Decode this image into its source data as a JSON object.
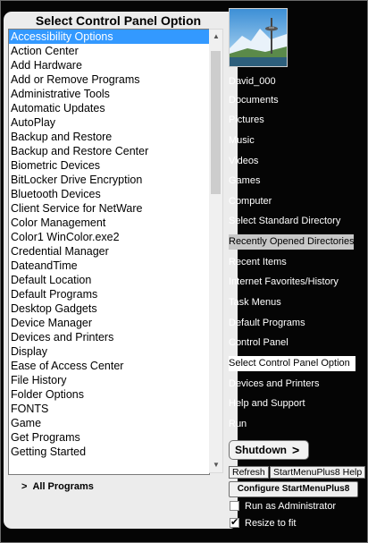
{
  "left_panel": {
    "title": "Select Control Panel Option",
    "items": [
      {
        "label": "Accessibility Options",
        "selected": true
      },
      {
        "label": "Action Center"
      },
      {
        "label": "Add Hardware"
      },
      {
        "label": "Add or Remove Programs"
      },
      {
        "label": "Administrative Tools"
      },
      {
        "label": "Automatic Updates"
      },
      {
        "label": "AutoPlay"
      },
      {
        "label": "Backup and Restore"
      },
      {
        "label": "Backup and Restore Center"
      },
      {
        "label": "Biometric Devices"
      },
      {
        "label": "BitLocker Drive Encryption"
      },
      {
        "label": "Bluetooth Devices"
      },
      {
        "label": "Client Service for NetWare"
      },
      {
        "label": "Color Management"
      },
      {
        "label": "Color1 WinColor.exe2"
      },
      {
        "label": "Credential Manager"
      },
      {
        "label": "DateandTime"
      },
      {
        "label": "Default Location"
      },
      {
        "label": "Default Programs"
      },
      {
        "label": "Desktop Gadgets"
      },
      {
        "label": "Device Manager"
      },
      {
        "label": "Devices and Printers"
      },
      {
        "label": "Display"
      },
      {
        "label": "Ease of Access Center"
      },
      {
        "label": "File History"
      },
      {
        "label": "Folder Options"
      },
      {
        "label": "FONTS"
      },
      {
        "label": "Game"
      },
      {
        "label": "Get Programs"
      },
      {
        "label": "Getting Started"
      }
    ],
    "all_programs": {
      "arrow": ">",
      "label": "All Programs"
    }
  },
  "right_panel": {
    "avatar_icon": "user-picture-space-needle",
    "items": [
      {
        "label": "David_000",
        "name": "user-name"
      },
      {
        "label": "Documents",
        "name": "menu-item-documents"
      },
      {
        "label": "Pictures",
        "name": "menu-item-pictures"
      },
      {
        "label": "Music",
        "name": "menu-item-music"
      },
      {
        "label": "Videos",
        "name": "menu-item-videos"
      },
      {
        "label": "Games",
        "name": "menu-item-games"
      },
      {
        "label": "Computer",
        "name": "menu-item-computer"
      },
      {
        "label": "Select Standard Directory",
        "name": "menu-item-select-standard-directory"
      },
      {
        "label": "Recently Opened Directories",
        "name": "menu-item-recently-opened-directories",
        "highlight": "gray"
      },
      {
        "label": "Recent Items",
        "name": "menu-item-recent-items"
      },
      {
        "label": "Internet Favorites/History",
        "name": "menu-item-internet-favorites-history"
      },
      {
        "label": "Task Menus",
        "name": "menu-item-task-menus"
      },
      {
        "label": "Default Programs",
        "name": "menu-item-default-programs"
      },
      {
        "label": "Control Panel",
        "name": "menu-item-control-panel"
      },
      {
        "label": "Select Control Panel Option",
        "name": "menu-item-select-control-panel-option",
        "highlight": "white"
      },
      {
        "label": "Devices and Printers",
        "name": "menu-item-devices-and-printers"
      },
      {
        "label": "Help and Support",
        "name": "menu-item-help-and-support"
      },
      {
        "label": "Run",
        "name": "menu-item-run"
      }
    ],
    "shutdown": {
      "label": "Shutdown",
      "chevron": ">"
    },
    "refresh_label": "Refresh",
    "help_label": "StartMenuPlus8 Help",
    "configure_label": "Configure StartMenuPlus8",
    "run_as_admin": {
      "label": "Run as Administrator",
      "checked": false
    },
    "resize_to_fit": {
      "label": "Resize to fit",
      "checked": true
    }
  },
  "colors": {
    "background": "#050505",
    "panel": "#ececec",
    "selection": "#3399ff",
    "highlight_gray": "#c8c8c8",
    "highlight_white": "#ffffff"
  }
}
